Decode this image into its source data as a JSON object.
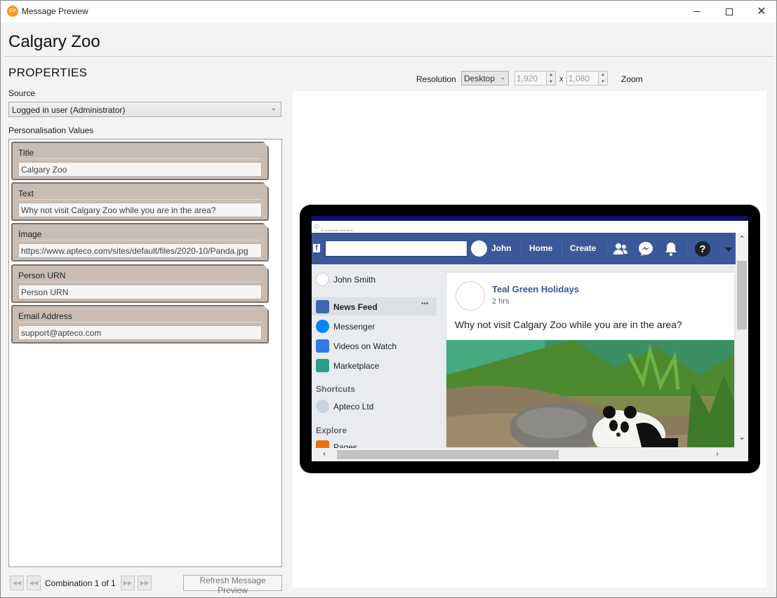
{
  "window": {
    "title": "Message Preview",
    "app_icon_text": "C#",
    "minimize_icon": "minimize-icon",
    "maximize_icon": "maximize-icon",
    "close_icon": "close-icon",
    "close_glyph": "✕"
  },
  "heading": "Calgary Zoo",
  "properties": {
    "title": "PROPERTIES",
    "source_label": "Source",
    "source_value": "Logged in user (Administrator)",
    "personalisation_label": "Personalisation Values",
    "fields": [
      {
        "label": "Title",
        "value": "Calgary Zoo"
      },
      {
        "label": "Text",
        "value": "Why not visit Calgary Zoo while you are in the area?"
      },
      {
        "label": "Image",
        "value": "https://www.apteco.com/sites/default/files/2020-10/Panda.jpg"
      },
      {
        "label": "Person URN",
        "value": "Person URN"
      },
      {
        "label": "Email Address",
        "value": "support@apteco.com"
      }
    ]
  },
  "navigation": {
    "combination_text": "Combination 1 of 1",
    "refresh_label": "Refresh Message Preview"
  },
  "toolbar": {
    "resolution_label": "Resolution",
    "resolution_value": "Desktop",
    "width_value": "1,920",
    "height_value": "1,080",
    "times": "x",
    "zoom_label": "Zoom"
  },
  "preview": {
    "header_small_text": "09 November 2020 09:47",
    "facebook": {
      "nav_user": "John",
      "nav_home": "Home",
      "nav_create": "Create",
      "left_user": "John Smith",
      "left_items": [
        "News Feed",
        "Messenger",
        "Videos on Watch",
        "Marketplace"
      ],
      "shortcuts_title": "Shortcuts",
      "shortcut_item": "Apteco Ltd",
      "explore_title": "Explore",
      "explore_item": "Pages",
      "more_dots": "•••",
      "post": {
        "author": "Teal Green Holidays",
        "time": "2 hrs",
        "text": "Why not visit Calgary Zoo while you are in the area?"
      }
    }
  },
  "colors": {
    "facebook_blue": "#3b5998",
    "card_bg": "#c9bdb3",
    "tablet_frame": "#000000"
  }
}
